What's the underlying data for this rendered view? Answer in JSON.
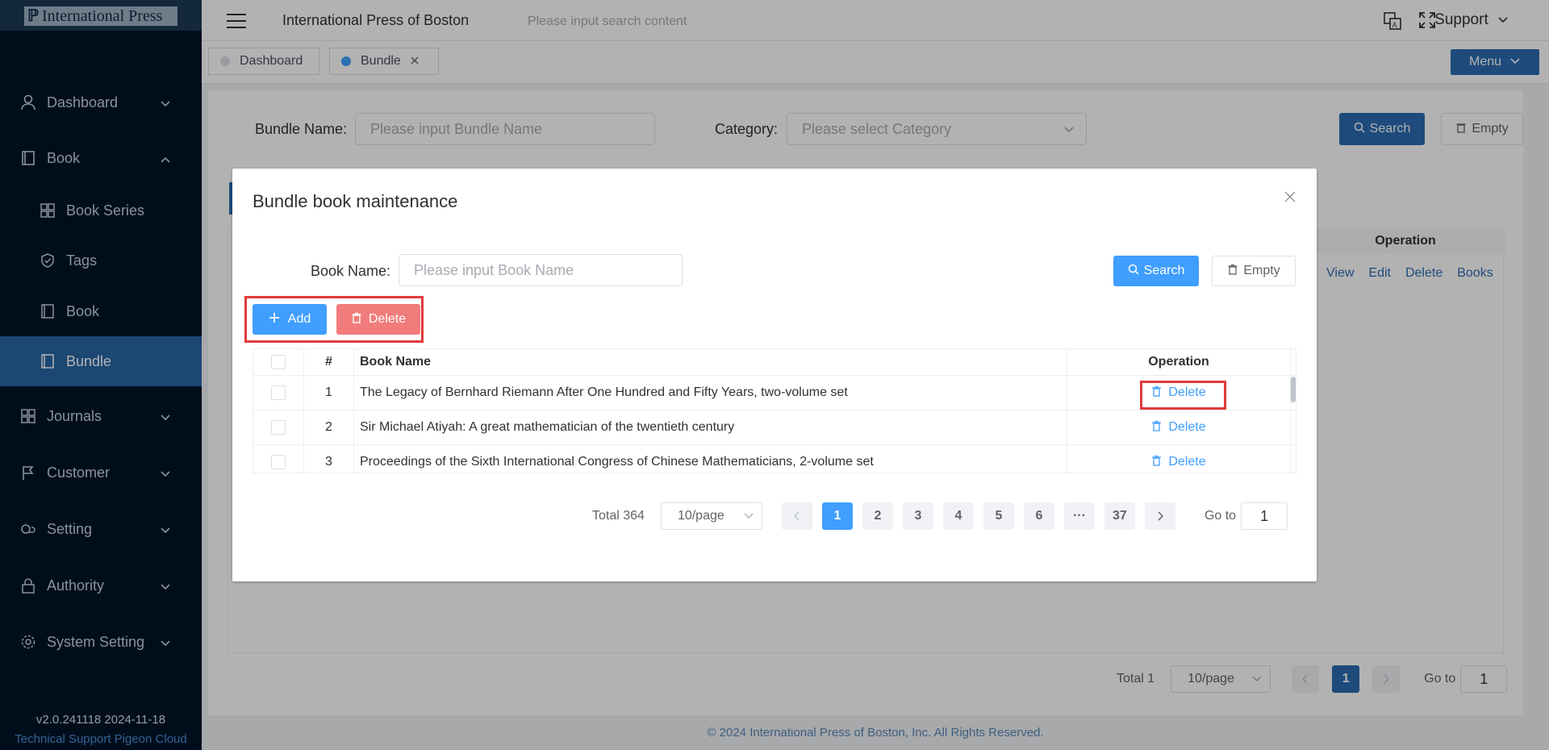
{
  "app": {
    "logo_text": "International Press",
    "site_title": "International Press of Boston",
    "search_placeholder": "Please input search content",
    "support_label": "Support"
  },
  "sidebar": {
    "items": [
      {
        "label": "Dashboard"
      },
      {
        "label": "Book"
      },
      {
        "label": "Book Series"
      },
      {
        "label": "Tags"
      },
      {
        "label": "Book"
      },
      {
        "label": "Bundle"
      },
      {
        "label": "Journals"
      },
      {
        "label": "Customer"
      },
      {
        "label": "Setting"
      },
      {
        "label": "Authority"
      },
      {
        "label": "System Setting"
      }
    ],
    "version": "v2.0.241118 2024-11-18",
    "support_text": "Technical Support Pigeon Cloud"
  },
  "tabs": [
    {
      "label": "Dashboard"
    },
    {
      "label": "Bundle"
    }
  ],
  "menu_button": "Menu",
  "filters": {
    "bundle_label": "Bundle Name:",
    "bundle_placeholder": "Please input Bundle Name",
    "category_label": "Category:",
    "category_placeholder": "Please select Category",
    "search_label": "Search",
    "empty_label": "Empty"
  },
  "bg_table": {
    "operation_header": "Operation",
    "ops": [
      "View",
      "Edit",
      "Delete",
      "Books"
    ]
  },
  "bg_pager": {
    "total": "Total 1",
    "page_size": "10/page",
    "current": "1",
    "goto_label": "Go to",
    "goto_value": "1"
  },
  "footer": "© 2024 International Press of Boston, Inc. All Rights Reserved.",
  "dialog": {
    "title": "Bundle book maintenance",
    "book_label": "Book Name:",
    "book_placeholder": "Please input Book Name",
    "search_label": "Search",
    "empty_label": "Empty",
    "add_label": "Add",
    "delete_label": "Delete",
    "columns": {
      "num": "#",
      "name": "Book Name",
      "operation": "Operation"
    },
    "rows": [
      {
        "num": "1",
        "name": "The Legacy of Bernhard Riemann After One Hundred and Fifty Years, two-volume set",
        "op": "Delete"
      },
      {
        "num": "2",
        "name": "Sir Michael Atiyah: A great mathematician of the twentieth century",
        "op": "Delete"
      },
      {
        "num": "3",
        "name": "Proceedings of the Sixth International Congress of Chinese Mathematicians, 2-volume set",
        "op": "Delete"
      }
    ],
    "pager": {
      "total": "Total 364",
      "page_size": "10/page",
      "pages": [
        "1",
        "2",
        "3",
        "4",
        "5",
        "6",
        "···",
        "37"
      ],
      "goto_label": "Go to",
      "goto_value": "1"
    }
  },
  "colors": {
    "sidebar_bg": "#001529",
    "active_item": "#2766a4",
    "primary": "#409eff",
    "danger_light": "#f27b7b",
    "highlight": "#e03b3b"
  }
}
